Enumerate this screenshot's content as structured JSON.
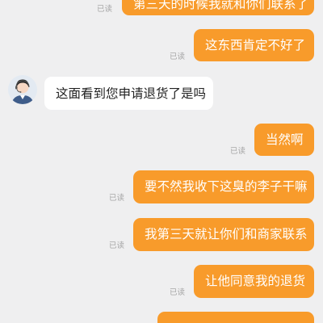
{
  "chat": {
    "read_label": "已读",
    "messages": [
      {
        "sender": "me",
        "text": "第三天的时候我就和你们联系了",
        "read": true
      },
      {
        "sender": "me",
        "text": "这东西肯定不好了",
        "read": true
      },
      {
        "sender": "agent",
        "text": "这面看到您申请退货了是吗",
        "read": false
      },
      {
        "sender": "me",
        "text": "当然啊",
        "read": true
      },
      {
        "sender": "me",
        "text": "要不然我收下这臭的李子干嘛",
        "read": true
      },
      {
        "sender": "me",
        "text": "我第三天就让你们和商家联系",
        "read": true
      },
      {
        "sender": "me",
        "text": "让他同意我的退货",
        "read": true
      },
      {
        "sender": "me",
        "text": "",
        "read": false
      }
    ]
  },
  "colors": {
    "background": "#efeff0",
    "my_bubble": "#f89b2b",
    "agent_bubble": "#ffffff",
    "read_text": "#a7a7a7"
  },
  "icons": {
    "agent_avatar": "customer-service-agent-avatar"
  }
}
